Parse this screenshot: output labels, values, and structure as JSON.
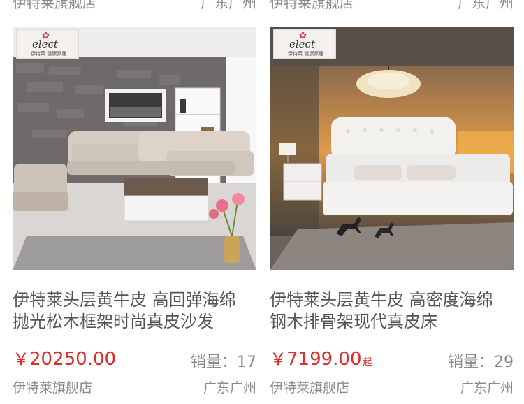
{
  "products": [
    {
      "prev_shop": "伊特莱旗舰店",
      "prev_location": "广东广州",
      "logo": {
        "brand": "elect",
        "tagline": "伊特莱 健康家居"
      },
      "title_line1": "伊特莱头层黄牛皮  高回弹海绵",
      "title_line2": "抛光松木框架时尚真皮沙发",
      "price_currency": "￥",
      "price": "20250.00",
      "price_suffix": "",
      "sales_label": "销量：",
      "sales": "17",
      "shop": "伊特莱旗舰店",
      "location": "广东广州"
    },
    {
      "prev_shop": "伊特莱旗舰店",
      "prev_location": "广东广州",
      "logo": {
        "brand": "elect",
        "tagline": "伊特莱 健康家居"
      },
      "title_line1": "伊特莱头层黄牛皮  高密度海绵",
      "title_line2": "钢木排骨架现代真皮床",
      "price_currency": "￥",
      "price": "7199.00",
      "price_suffix": "起",
      "sales_label": "销量：",
      "sales": "29",
      "shop": "伊特莱旗舰店",
      "location": "广东广州"
    }
  ]
}
